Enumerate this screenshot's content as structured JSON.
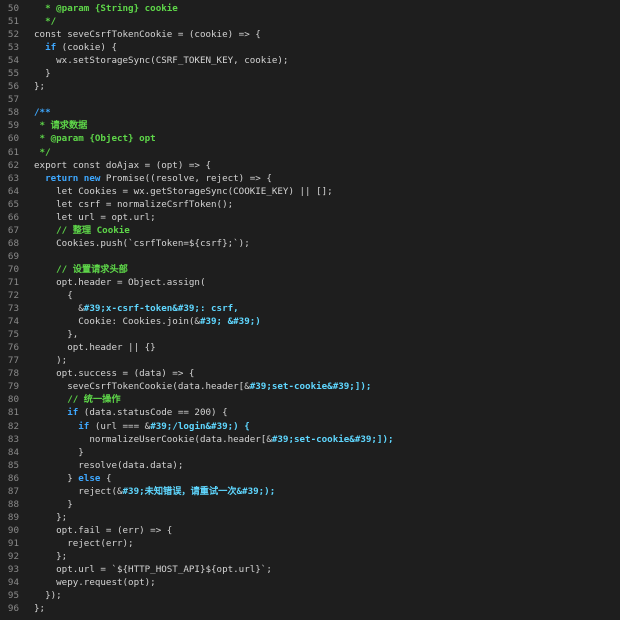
{
  "editor": {
    "lines": [
      {
        "n": "50",
        "t": [
          {
            "c": "cm",
            "s": "  * @param {String} cookie"
          }
        ]
      },
      {
        "n": "51",
        "t": [
          {
            "c": "cm",
            "s": "  */"
          }
        ]
      },
      {
        "n": "52",
        "t": [
          {
            "c": "pl",
            "s": "const seveCsrfTokenCookie = (cookie) => {"
          }
        ]
      },
      {
        "n": "53",
        "t": [
          {
            "c": "kw",
            "s": "  if"
          },
          {
            "c": "pl",
            "s": " (cookie) {"
          }
        ]
      },
      {
        "n": "54",
        "t": [
          {
            "c": "pl",
            "s": "    wx.setStorageSync(CSRF_TOKEN_KEY, cookie);"
          }
        ]
      },
      {
        "n": "55",
        "t": [
          {
            "c": "pl",
            "s": "  }"
          }
        ]
      },
      {
        "n": "56",
        "t": [
          {
            "c": "pl",
            "s": "};"
          }
        ]
      },
      {
        "n": "57",
        "t": [
          {
            "c": "pl",
            "s": ""
          }
        ]
      },
      {
        "n": "58",
        "t": [
          {
            "c": "doc",
            "s": "/**"
          }
        ]
      },
      {
        "n": "59",
        "t": [
          {
            "c": "cm",
            "s": " * 请求数据"
          }
        ]
      },
      {
        "n": "60",
        "t": [
          {
            "c": "cm",
            "s": " * @param {Object} opt"
          }
        ]
      },
      {
        "n": "61",
        "t": [
          {
            "c": "cm",
            "s": " */"
          }
        ]
      },
      {
        "n": "62",
        "t": [
          {
            "c": "pl",
            "s": "export const doAjax = (opt) => {"
          }
        ]
      },
      {
        "n": "63",
        "t": [
          {
            "c": "kw",
            "s": "  return new"
          },
          {
            "c": "pl",
            "s": " Promise((resolve, reject) => {"
          }
        ]
      },
      {
        "n": "64",
        "t": [
          {
            "c": "pl",
            "s": "    let Cookies = wx.getStorageSync(COOKIE_KEY) || [];"
          }
        ]
      },
      {
        "n": "65",
        "t": [
          {
            "c": "pl",
            "s": "    let csrf = normalizeCsrfToken();"
          }
        ]
      },
      {
        "n": "66",
        "t": [
          {
            "c": "pl",
            "s": "    let url = opt.url;"
          }
        ]
      },
      {
        "n": "67",
        "t": [
          {
            "c": "cm",
            "s": "    // 整理 Cookie"
          }
        ]
      },
      {
        "n": "68",
        "t": [
          {
            "c": "pl",
            "s": "    Cookies.push(`csrfToken=${csrf};`);"
          }
        ]
      },
      {
        "n": "69",
        "t": [
          {
            "c": "pl",
            "s": ""
          }
        ]
      },
      {
        "n": "70",
        "t": [
          {
            "c": "cm",
            "s": "    // 设置请求头部"
          }
        ]
      },
      {
        "n": "71",
        "t": [
          {
            "c": "pl",
            "s": "    opt.header = Object.assign("
          }
        ]
      },
      {
        "n": "72",
        "t": [
          {
            "c": "pl",
            "s": "      {"
          }
        ]
      },
      {
        "n": "73",
        "t": [
          {
            "c": "pl",
            "s": "        &"
          },
          {
            "c": "str",
            "s": "#39;x-csrf-token&#39;: csrf,"
          }
        ]
      },
      {
        "n": "74",
        "t": [
          {
            "c": "pl",
            "s": "        Cookie: Cookies.join(&"
          },
          {
            "c": "str",
            "s": "#39; &#39;)"
          }
        ]
      },
      {
        "n": "75",
        "t": [
          {
            "c": "pl",
            "s": "      },"
          }
        ]
      },
      {
        "n": "76",
        "t": [
          {
            "c": "pl",
            "s": "      opt.header || {}"
          }
        ]
      },
      {
        "n": "77",
        "t": [
          {
            "c": "pl",
            "s": "    );"
          }
        ]
      },
      {
        "n": "78",
        "t": [
          {
            "c": "pl",
            "s": "    opt.success = (data) => {"
          }
        ]
      },
      {
        "n": "79",
        "t": [
          {
            "c": "pl",
            "s": "      seveCsrfTokenCookie(data.header[&"
          },
          {
            "c": "str",
            "s": "#39;set-cookie&#39;]);"
          }
        ]
      },
      {
        "n": "80",
        "t": [
          {
            "c": "cm",
            "s": "      // 统一操作"
          }
        ]
      },
      {
        "n": "81",
        "t": [
          {
            "c": "kw",
            "s": "      if"
          },
          {
            "c": "pl",
            "s": " (data.statusCode == 200) {"
          }
        ]
      },
      {
        "n": "82",
        "t": [
          {
            "c": "kw",
            "s": "        if"
          },
          {
            "c": "pl",
            "s": " (url === &"
          },
          {
            "c": "str",
            "s": "#39;/login&#39;) {"
          }
        ]
      },
      {
        "n": "83",
        "t": [
          {
            "c": "pl",
            "s": "          normalizeUserCookie(data.header[&"
          },
          {
            "c": "str",
            "s": "#39;set-cookie&#39;]);"
          }
        ]
      },
      {
        "n": "84",
        "t": [
          {
            "c": "pl",
            "s": "        }"
          }
        ]
      },
      {
        "n": "85",
        "t": [
          {
            "c": "pl",
            "s": "        resolve(data.data);"
          }
        ]
      },
      {
        "n": "86",
        "t": [
          {
            "c": "pl",
            "s": "      } "
          },
          {
            "c": "kw",
            "s": "else"
          },
          {
            "c": "pl",
            "s": " {"
          }
        ]
      },
      {
        "n": "87",
        "t": [
          {
            "c": "pl",
            "s": "        reject(&"
          },
          {
            "c": "str",
            "s": "#39;未知错误，请重试一次&#39;);"
          }
        ]
      },
      {
        "n": "88",
        "t": [
          {
            "c": "pl",
            "s": "      }"
          }
        ]
      },
      {
        "n": "89",
        "t": [
          {
            "c": "pl",
            "s": "    };"
          }
        ]
      },
      {
        "n": "90",
        "t": [
          {
            "c": "pl",
            "s": "    opt.fail = (err) => {"
          }
        ]
      },
      {
        "n": "91",
        "t": [
          {
            "c": "pl",
            "s": "      reject(err);"
          }
        ]
      },
      {
        "n": "92",
        "t": [
          {
            "c": "pl",
            "s": "    };"
          }
        ]
      },
      {
        "n": "93",
        "t": [
          {
            "c": "pl",
            "s": "    opt.url = `${HTTP_HOST_API}${opt.url}`;"
          }
        ]
      },
      {
        "n": "94",
        "t": [
          {
            "c": "pl",
            "s": "    wepy.request(opt);"
          }
        ]
      },
      {
        "n": "95",
        "t": [
          {
            "c": "pl",
            "s": "  });"
          }
        ]
      },
      {
        "n": "96",
        "t": [
          {
            "c": "pl",
            "s": "};"
          }
        ]
      }
    ]
  }
}
